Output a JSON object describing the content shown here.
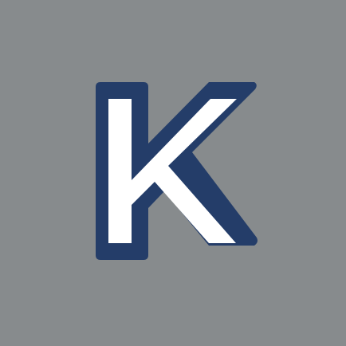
{
  "logo": {
    "icon": "letter-k-icon",
    "letter": "K",
    "colors": {
      "background": "#878b8d",
      "outline": "#243d69",
      "fill": "#ffffff"
    }
  }
}
